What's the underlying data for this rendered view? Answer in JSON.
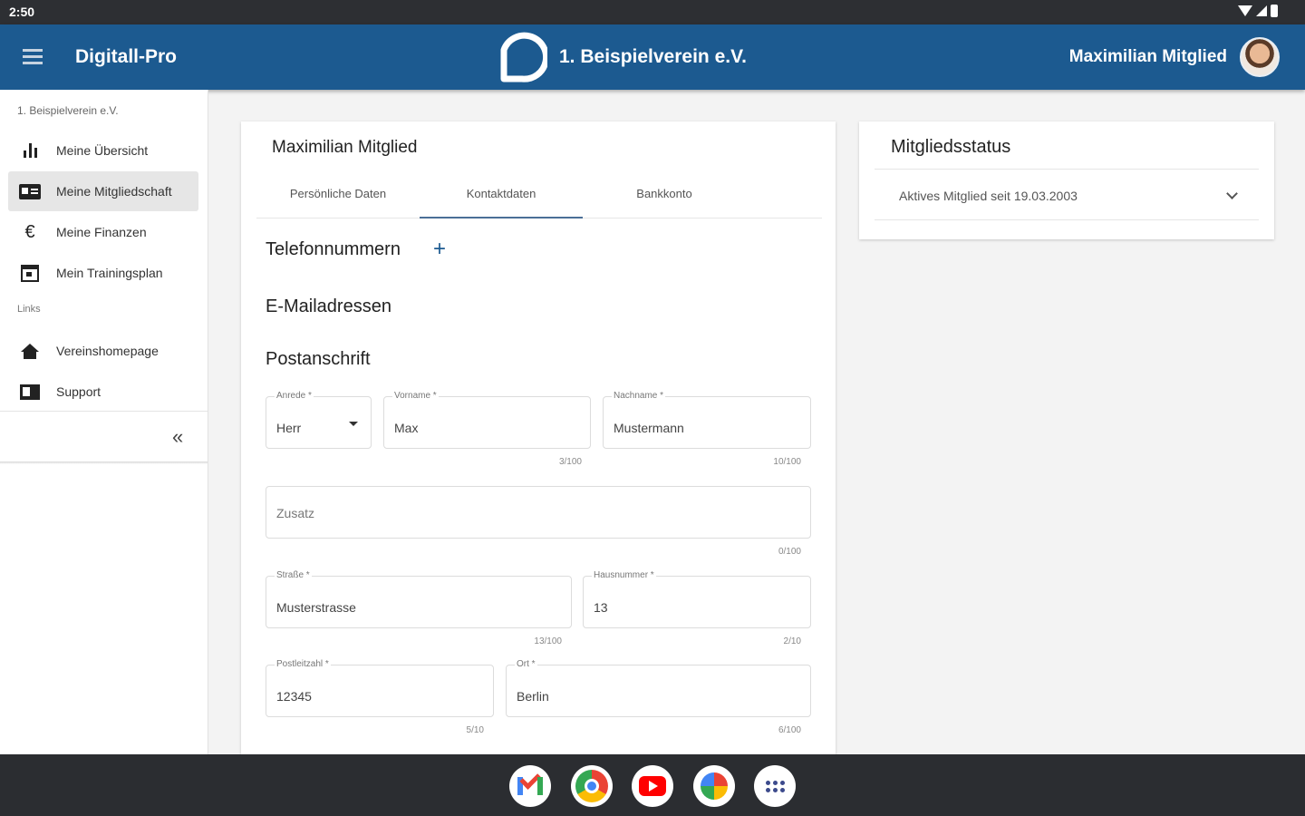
{
  "status_bar": {
    "time": "2:50"
  },
  "app_bar": {
    "app_name": "Digitall-Pro",
    "club_name": "1. Beispielverein e.V.",
    "user_name": "Maximilian Mitglied"
  },
  "sidebar": {
    "org": "1. Beispielverein e.V.",
    "items": [
      {
        "label": "Meine Übersicht",
        "icon": "bar-chart-icon"
      },
      {
        "label": "Meine Mitgliedschaft",
        "icon": "id-card-icon"
      },
      {
        "label": "Meine Finanzen",
        "icon": "euro-icon"
      },
      {
        "label": "Mein Trainingsplan",
        "icon": "calendar-icon"
      }
    ],
    "links_label": "Links",
    "links": [
      {
        "label": "Vereinshomepage",
        "icon": "home-icon"
      },
      {
        "label": "Support",
        "icon": "support-icon"
      }
    ],
    "collapse_glyph": "«",
    "active_item": "Meine Mitgliedschaft"
  },
  "main": {
    "title": "Maximilian Mitglied",
    "tabs": [
      "Persönliche Daten",
      "Kontaktdaten",
      "Bankkonto"
    ],
    "active_tab": "Kontaktdaten",
    "sections": {
      "phones": "Telefonnummern",
      "emails": "E-Mailadressen",
      "address": "Postanschrift"
    },
    "add_glyph": "+",
    "form": {
      "anrede": {
        "label": "Anrede *",
        "value": "Herr"
      },
      "vorname": {
        "label": "Vorname *",
        "value": "Max",
        "counter": "3/100"
      },
      "nachname": {
        "label": "Nachname *",
        "value": "Mustermann",
        "counter": "10/100"
      },
      "zusatz": {
        "placeholder": "Zusatz",
        "counter": "0/100"
      },
      "strasse": {
        "label": "Straße *",
        "value": "Musterstrasse",
        "counter": "13/100"
      },
      "hausnummer": {
        "label": "Hausnummer *",
        "value": "13",
        "counter": "2/10"
      },
      "plz": {
        "label": "Postleitzahl *",
        "value": "12345",
        "counter": "5/10"
      },
      "ort": {
        "label": "Ort *",
        "value": "Berlin",
        "counter": "6/100"
      }
    }
  },
  "status_panel": {
    "title": "Mitgliedsstatus",
    "entry": "Aktives Mitglied seit 19.03.2003"
  },
  "taskbar": {
    "apps": [
      "gmail-icon",
      "chrome-icon",
      "youtube-icon",
      "photos-icon",
      "app-drawer-icon"
    ]
  },
  "colors": {
    "app_bar": "#1c5a90",
    "status_bar": "#2d2f33",
    "taskbar": "#2b2d31",
    "tab_indicator": "#4b6f97",
    "background": "#f3f3f3"
  }
}
